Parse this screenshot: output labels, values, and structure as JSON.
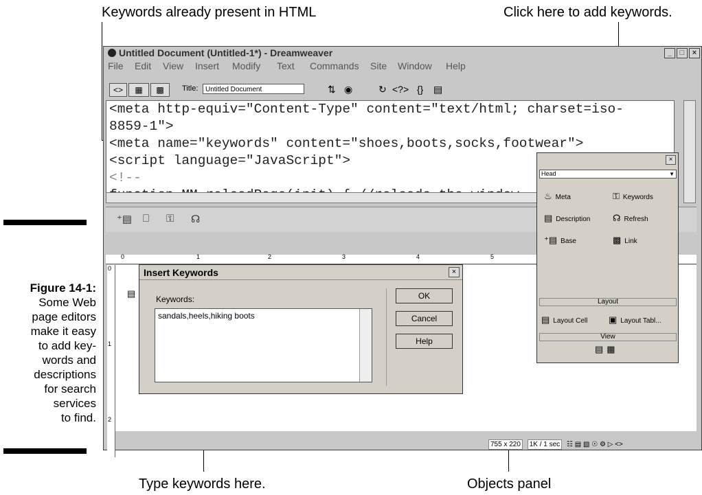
{
  "callouts": {
    "top_left": "Keywords already present in HTML",
    "top_right": "Click here to add keywords.",
    "bottom_left": "Type keywords here.",
    "bottom_right": "Objects panel"
  },
  "caption": {
    "figure": "Figure 14-1:",
    "lines": [
      "Some Web",
      "page editors",
      "make it easy",
      "to add key-",
      "words and",
      "descriptions",
      "for search",
      "services",
      "to find."
    ]
  },
  "window": {
    "title": "Untitled Document (Untitled-1*) - Dreamweaver",
    "controls": [
      "_",
      "□",
      "×"
    ],
    "menu": [
      "File",
      "Edit",
      "View",
      "Insert",
      "Modify",
      "Text",
      "Commands",
      "Site",
      "Window",
      "Help"
    ],
    "toolbar": {
      "title_label": "Title:",
      "title_value": "Untitled Document"
    }
  },
  "code": {
    "lines": [
      "<meta http-equiv=\"Content-Type\" content=\"text/html; charset=iso-",
      "8859-1\">",
      "<meta name=\"keywords\" content=\"shoes,boots,socks,footwear\">",
      "<script language=\"JavaScript\">",
      "<!--",
      "function MM_reloadPage(init) {  //reloads the window"
    ]
  },
  "ruler": {
    "h": [
      "0",
      "1",
      "2",
      "3",
      "4",
      "5"
    ],
    "v": [
      "0",
      "1",
      "2"
    ]
  },
  "status": {
    "size": "755 x 220",
    "speed": "1K / 1 sec"
  },
  "dialog": {
    "title": "Insert Keywords",
    "close": "×",
    "label": "Keywords:",
    "value": "sandals,heels,hiking boots",
    "buttons": [
      "OK",
      "Cancel",
      "Help"
    ]
  },
  "panel": {
    "close": "×",
    "category": "Head",
    "items": [
      {
        "label": "Meta",
        "icon": "meta-icon"
      },
      {
        "label": "Keywords",
        "icon": "keywords-icon"
      },
      {
        "label": "Description",
        "icon": "description-icon"
      },
      {
        "label": "Refresh",
        "icon": "refresh-icon"
      },
      {
        "label": "Base",
        "icon": "base-icon"
      },
      {
        "label": "Link",
        "icon": "link-icon"
      }
    ],
    "layout_header": "Layout",
    "layout_items": [
      "Layout Cell",
      "Layout Tabl..."
    ],
    "view_header": "View"
  }
}
